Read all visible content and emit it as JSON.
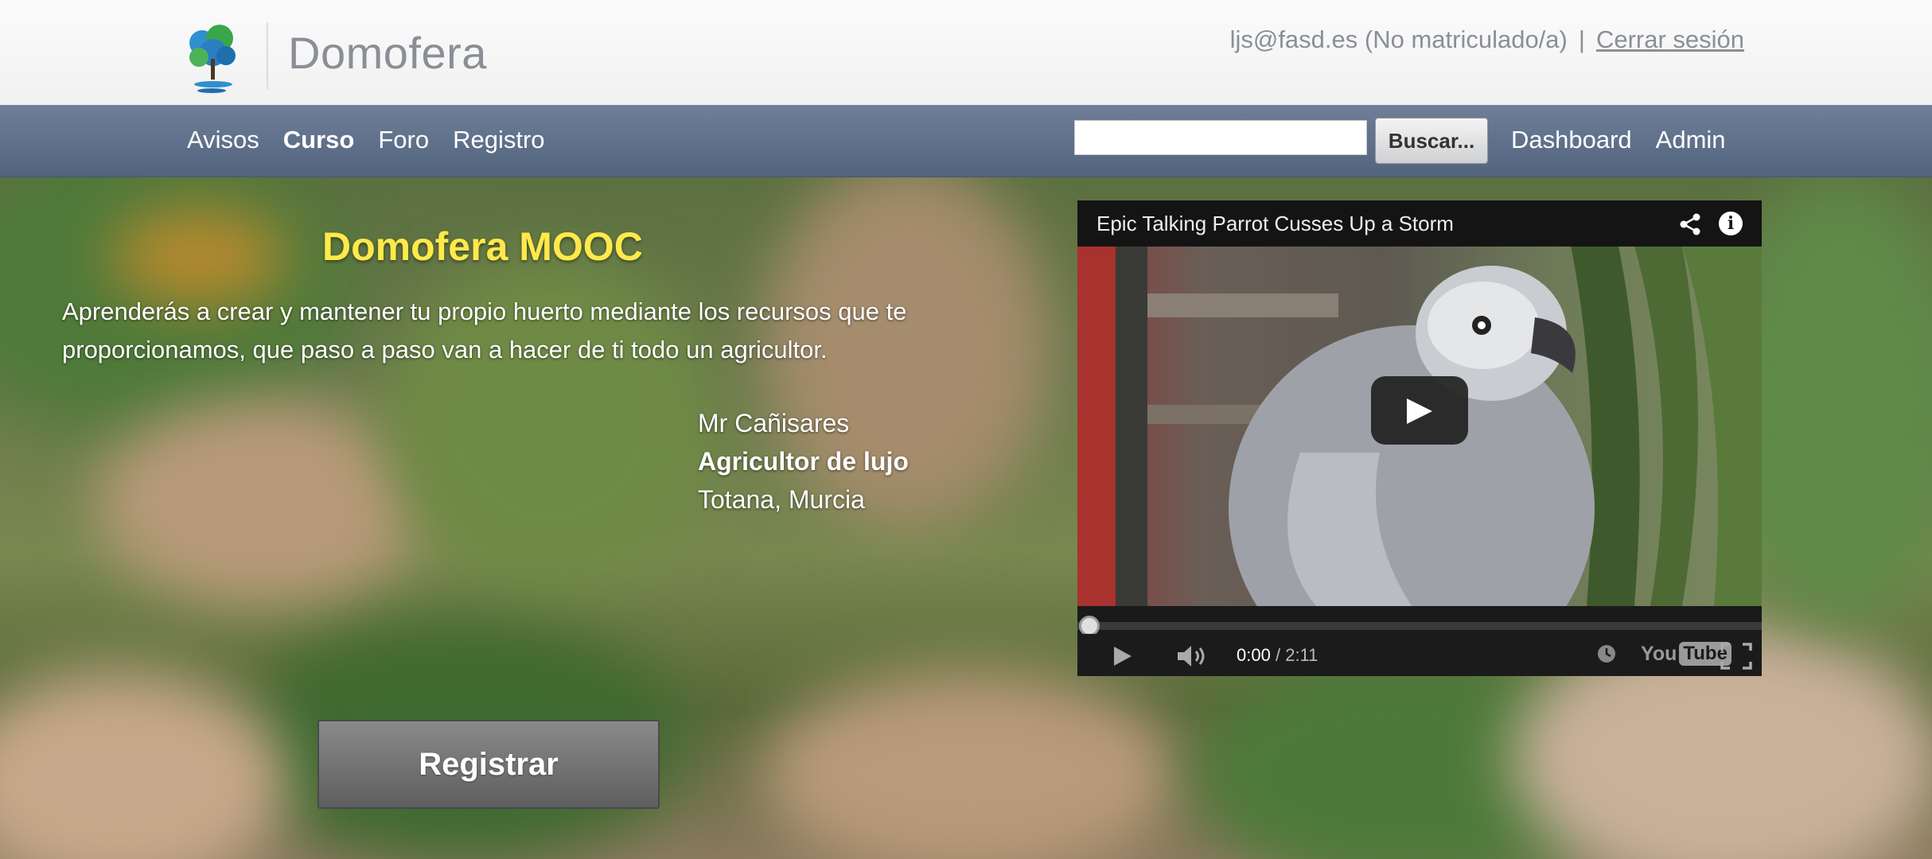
{
  "header": {
    "brand": "Domofera",
    "user_email": "ljs@fasd.es (No matriculado/a)",
    "separator": "|",
    "logout_label": "Cerrar sesión"
  },
  "nav": {
    "items": [
      {
        "label": "Avisos",
        "active": false
      },
      {
        "label": "Curso",
        "active": true
      },
      {
        "label": "Foro",
        "active": false
      },
      {
        "label": "Registro",
        "active": false
      }
    ],
    "search_value": "",
    "search_button": "Buscar...",
    "right_items": [
      {
        "label": "Dashboard"
      },
      {
        "label": "Admin"
      }
    ]
  },
  "hero": {
    "title": "Domofera MOOC",
    "description": "Aprenderás a crear y mantener tu propio huerto mediante los recursos que te proporcionamos, que paso a paso van a hacer de ti todo un agricultor.",
    "quote_author": "Mr Cañisares",
    "quote_role": "Agricultor de lujo",
    "quote_location": "Totana, Murcia",
    "register_label": "Registrar"
  },
  "video": {
    "title": "Epic Talking Parrot Cusses Up a Storm",
    "current_time": "0:00",
    "time_separator": "/",
    "duration": "2:11",
    "progress": 0,
    "logo_you": "You",
    "logo_tube": "Tube"
  },
  "colors": {
    "title_yellow": "#ffe94a",
    "navbar": "#5f7089",
    "brand_gray": "#8a8f96"
  }
}
